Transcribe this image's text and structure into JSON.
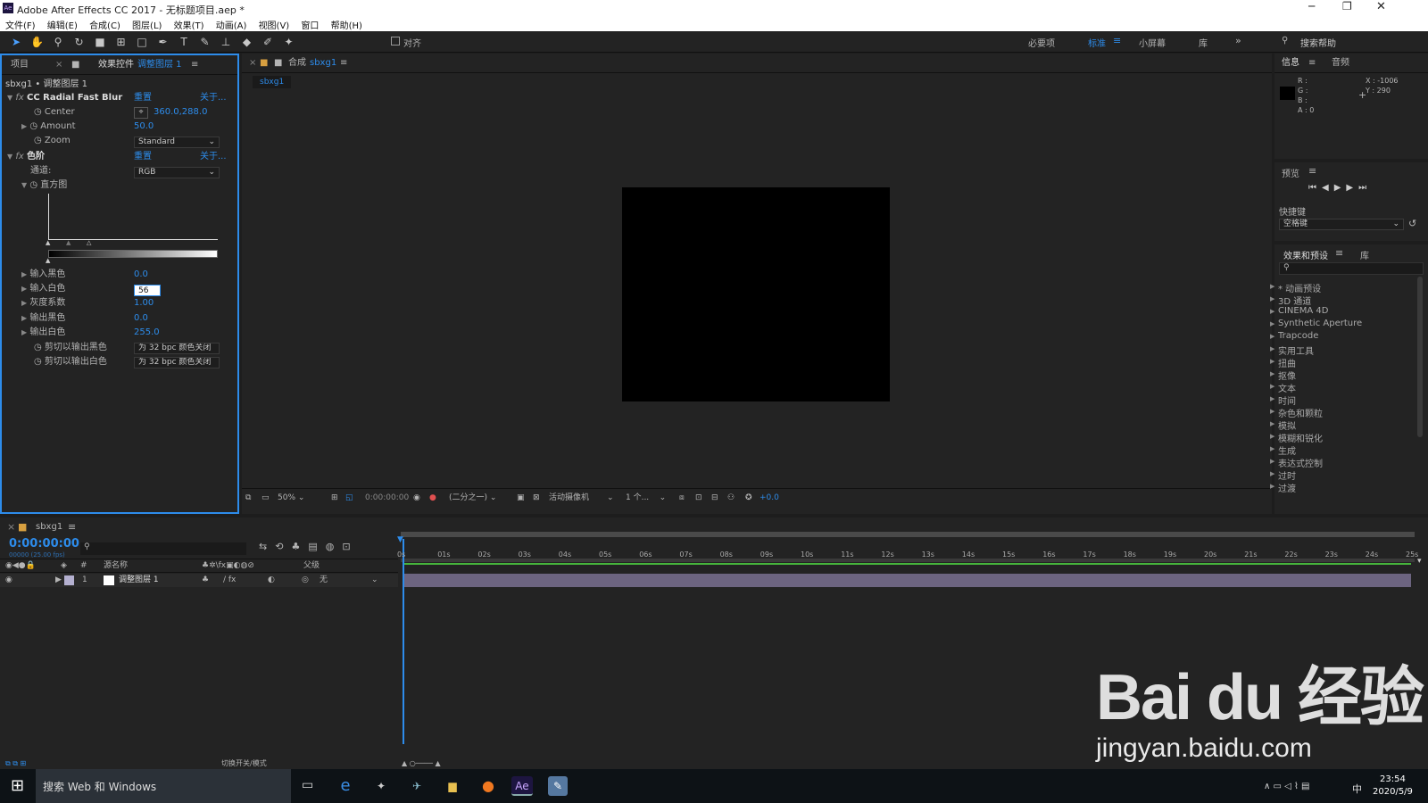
{
  "app": {
    "title": "Adobe After Effects CC 2017 - 无标题项目.aep *",
    "logo": "Ae"
  },
  "menu": [
    "文件(F)",
    "编辑(E)",
    "合成(C)",
    "图层(L)",
    "效果(T)",
    "动画(A)",
    "视图(V)",
    "窗口",
    "帮助(H)"
  ],
  "toolbar": {
    "snap_label": "对齐",
    "workspaces": [
      "必要项",
      "标准",
      "小屏幕",
      "库"
    ],
    "active_workspace": "标准",
    "search_placeholder": "搜索帮助"
  },
  "project_panel": {
    "tab_project": "项目",
    "tab_effects": "效果控件",
    "tab_layer": "调整图层 1",
    "breadcrumb": "sbxg1 • 调整图层 1"
  },
  "effects": {
    "radial_blur": {
      "name": "CC Radial Fast Blur",
      "reset": "重置",
      "about": "关于...",
      "center_label": "Center",
      "center_value": "360.0,288.0",
      "amount_label": "Amount",
      "amount_value": "50.0",
      "zoom_label": "Zoom",
      "zoom_value": "Standard"
    },
    "levels": {
      "name": "色阶",
      "reset": "重置",
      "about": "关于...",
      "channel_label": "通道:",
      "channel_value": "RGB",
      "histogram_label": "直方图",
      "input_black_label": "输入黑色",
      "input_black": "0.0",
      "input_white_label": "输入白色",
      "input_white": "56",
      "gamma_label": "灰度系数",
      "gamma": "1.00",
      "output_black_label": "输出黑色",
      "output_black": "0.0",
      "output_white_label": "输出白色",
      "output_white": "255.0",
      "clip_black_label": "剪切以输出黑色",
      "clip_black_value": "为 32 bpc 颜色关闭",
      "clip_white_label": "剪切以输出白色",
      "clip_white_value": "为 32 bpc 颜色关闭"
    }
  },
  "composition": {
    "tab_prefix": "合成",
    "name": "sbxg1",
    "subtab": "sbxg1",
    "zoom": "50%",
    "timecode": "0:00:00:00",
    "resolution": "(二分之一)",
    "camera": "活动摄像机",
    "views": "1 个...",
    "exposure": "+0.0"
  },
  "info_panel": {
    "tab_info": "信息",
    "tab_audio": "音频",
    "r": "R :",
    "g": "G :",
    "b": "B :",
    "a": "A : 0",
    "x": "X : -1006",
    "y": "Y : 290"
  },
  "preview_panel": {
    "title": "预览",
    "shortcut_label": "快捷键",
    "shortcut_value": "空格键"
  },
  "effects_presets": {
    "title": "效果和预设",
    "tab_lib": "库",
    "items": [
      "* 动画预设",
      "3D 通道",
      "CINEMA 4D",
      "Synthetic Aperture",
      "Trapcode",
      "实用工具",
      "扭曲",
      "抠像",
      "文本",
      "时间",
      "杂色和颗粒",
      "模拟",
      "模糊和锐化",
      "生成",
      "表达式控制",
      "过时",
      "过渡"
    ]
  },
  "timeline": {
    "tab": "sbxg1",
    "timecode": "0:00:00:00",
    "fps": "00000 (25.00 fps)",
    "col_source": "源名称",
    "col_parent": "父级",
    "layer_num": "1",
    "layer_name": "调整图层 1",
    "layer_parent": "无",
    "toggle_label": "切换开关/模式",
    "ruler": [
      "0s",
      "01s",
      "02s",
      "03s",
      "04s",
      "05s",
      "06s",
      "07s",
      "08s",
      "09s",
      "10s",
      "11s",
      "12s",
      "13s",
      "14s",
      "15s",
      "16s",
      "17s",
      "18s",
      "19s",
      "20s",
      "21s",
      "22s",
      "23s",
      "24s",
      "25s"
    ]
  },
  "taskbar": {
    "search": "搜索 Web 和 Windows",
    "time": "23:54",
    "date": "2020/5/9",
    "ime": "中"
  },
  "watermark": {
    "brand": "Bai du 经验",
    "url": "jingyan.baidu.com"
  },
  "colors": {
    "accent": "#2d8ceb",
    "panel": "#232323",
    "bg": "#1d1d1d",
    "layer_bar": "#6c6480",
    "green": "#46b43c"
  }
}
